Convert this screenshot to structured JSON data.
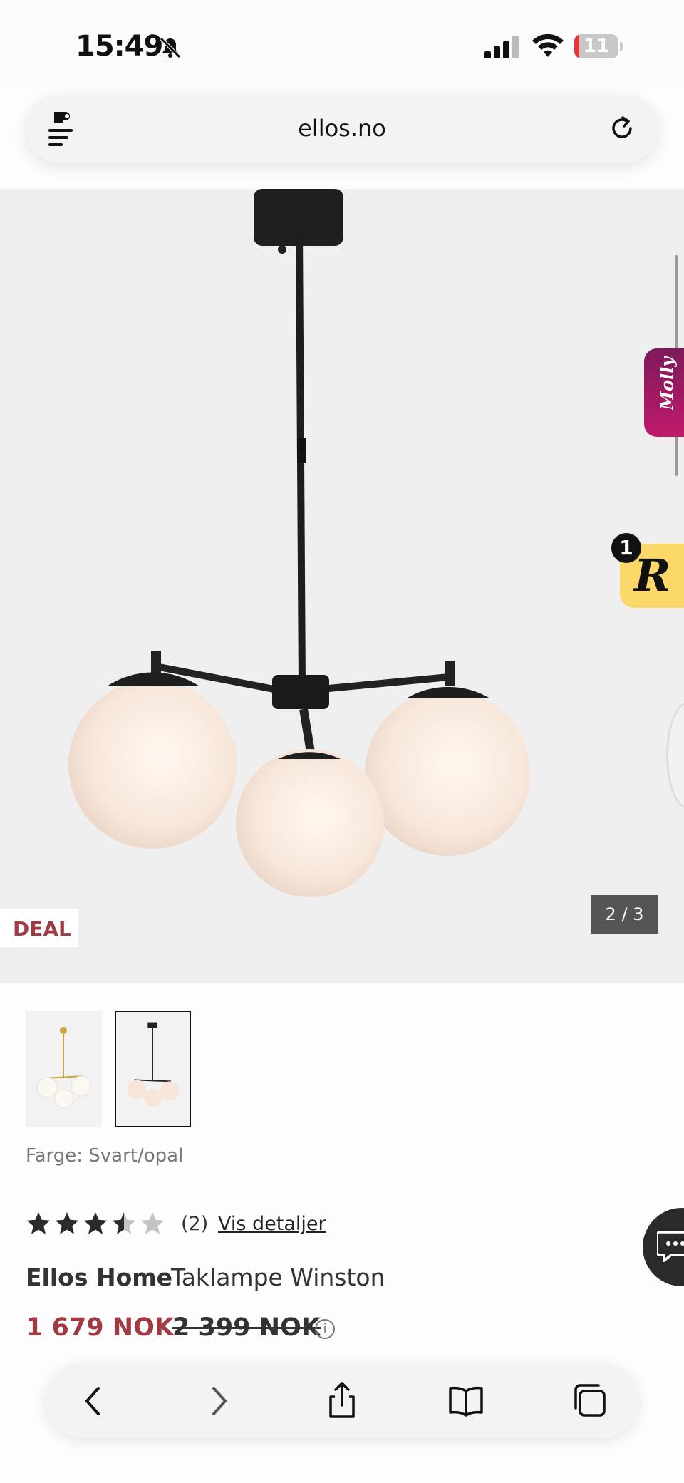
{
  "status_bar": {
    "time": "15:49",
    "battery_level": "11",
    "battery_fraction": 0.11
  },
  "browser": {
    "url": "ellos.no"
  },
  "gallery": {
    "deal_label": "DEAL",
    "counter": "2 / 3",
    "molly_label": "Molly",
    "rewards_letter": "R",
    "rewards_count": "1"
  },
  "product": {
    "color_label": "Farge: Svart/opal",
    "rating": 3.5,
    "rating_max": 5,
    "review_count": "(2)",
    "details_link": "Vis detaljer",
    "brand": "Ellos Home",
    "name": "Taklampe Winston",
    "price_sale": "1 679 NOK",
    "price_original": "2 399 NOK",
    "info_icon": "i"
  },
  "colors": {
    "sale_price": "#a23a44",
    "molly_gradient_top": "#7d1a5a",
    "rewards_bg": "#fcd86a"
  }
}
